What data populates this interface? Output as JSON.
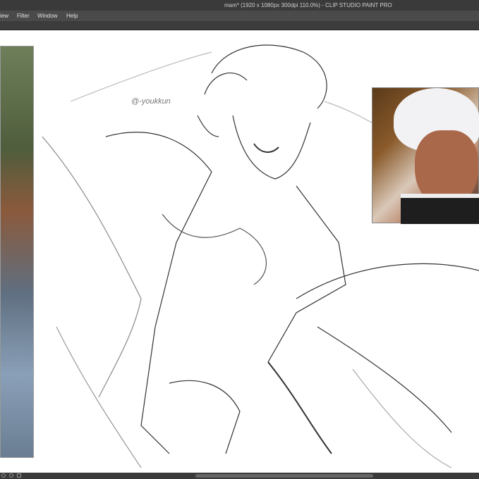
{
  "window": {
    "title": "mam* (1920 x 1080px 300dpi 110.0%)  - CLIP STUDIO PAINT PRO"
  },
  "menu": {
    "items": [
      "iew",
      "Filter",
      "Window",
      "Help"
    ]
  },
  "canvas": {
    "watermark": "@-youkkun"
  },
  "colors": {
    "chrome": "#3a3a3a",
    "menubar": "#4a4a4a",
    "canvas": "#ffffff"
  }
}
